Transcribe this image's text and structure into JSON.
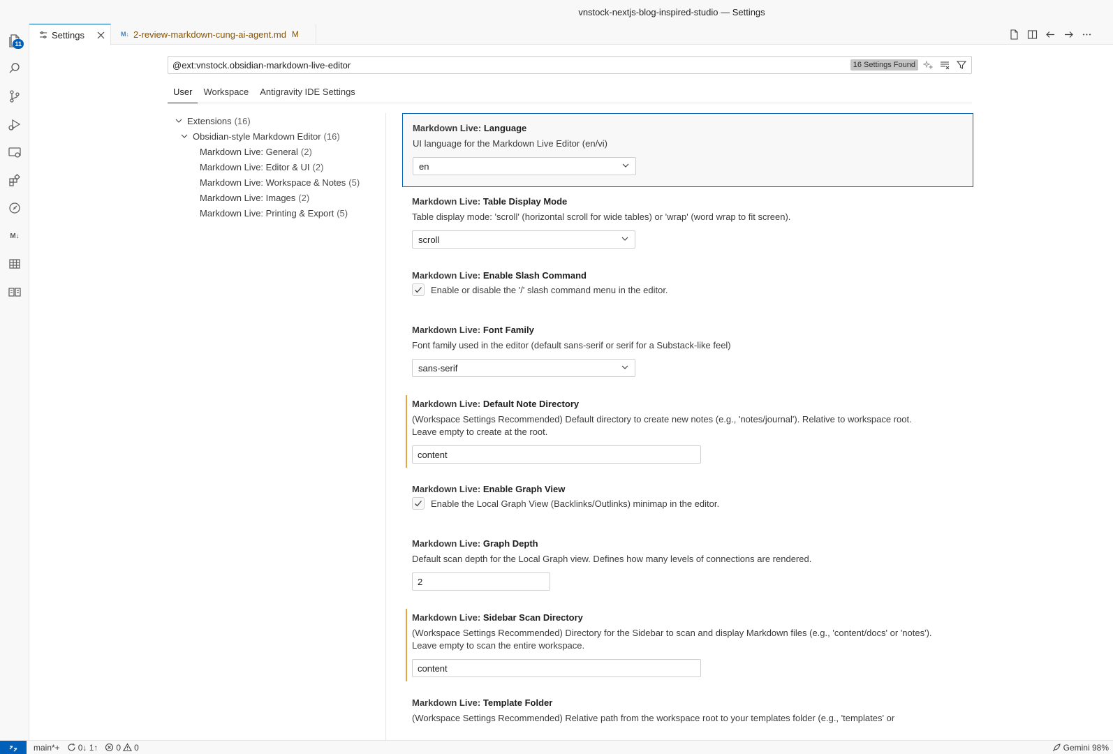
{
  "window": {
    "title": "vnstock-nextjs-blog-inspired-studio — Settings"
  },
  "activity_bar": {
    "explorer_badge": "11",
    "markdown_label": "M↓"
  },
  "tabs": [
    {
      "label": "Settings",
      "active": true
    },
    {
      "label": "2-review-markdown-cung-ai-agent.md",
      "flag": "M",
      "icon_text": "M↓"
    }
  ],
  "search": {
    "value": "@ext:vnstock.obsidian-markdown-live-editor",
    "results": "16 Settings Found"
  },
  "scopes": [
    "User",
    "Workspace",
    "Antigravity IDE Settings"
  ],
  "toc": [
    {
      "label": "Extensions",
      "count": "(16)"
    },
    {
      "label": "Obsidian-style Markdown Editor",
      "count": "(16)"
    },
    {
      "label": "Markdown Live: General",
      "count": "(2)"
    },
    {
      "label": "Markdown Live: Editor & UI",
      "count": "(2)"
    },
    {
      "label": "Markdown Live: Workspace & Notes",
      "count": "(5)"
    },
    {
      "label": "Markdown Live: Images",
      "count": "(2)"
    },
    {
      "label": "Markdown Live: Printing & Export",
      "count": "(5)"
    }
  ],
  "settings": [
    {
      "category": "Markdown Live: ",
      "key": "Language",
      "desc": "UI language for the Markdown Live Editor (en/vi)",
      "value": "en"
    },
    {
      "category": "Markdown Live: ",
      "key": "Table Display Mode",
      "desc": "Table display mode: 'scroll' (horizontal scroll for wide tables) or 'wrap' (word wrap to fit screen).",
      "value": "scroll"
    },
    {
      "category": "Markdown Live: ",
      "key": "Enable Slash Command",
      "desc": "Enable or disable the '/' slash command menu in the editor."
    },
    {
      "category": "Markdown Live: ",
      "key": "Font Family",
      "desc": "Font family used in the editor (default sans-serif or serif for a Substack-like feel)",
      "value": "sans-serif"
    },
    {
      "category": "Markdown Live: ",
      "key": "Default Note Directory",
      "desc1": "(Workspace Settings Recommended) Default directory to create new notes (e.g., 'notes/journal'). Relative to workspace root.",
      "desc2": "Leave empty to create at the root.",
      "value": "content"
    },
    {
      "category": "Markdown Live: ",
      "key": "Enable Graph View",
      "desc": "Enable the Local Graph View (Backlinks/Outlinks) minimap in the editor."
    },
    {
      "category": "Markdown Live: ",
      "key": "Graph Depth",
      "desc": "Default scan depth for the Local Graph view. Defines how many levels of connections are rendered.",
      "value": "2"
    },
    {
      "category": "Markdown Live: ",
      "key": "Sidebar Scan Directory",
      "desc1": "(Workspace Settings Recommended) Directory for the Sidebar to scan and display Markdown files (e.g., 'content/docs' or 'notes').",
      "desc2": "Leave empty to scan the entire workspace.",
      "value": "content"
    },
    {
      "category": "Markdown Live: ",
      "key": "Template Folder",
      "desc": "(Workspace Settings Recommended) Relative path from the workspace root to your templates folder (e.g., 'templates' or"
    }
  ],
  "status_bar": {
    "branch": "main*+",
    "sync": "0↓ 1↑",
    "errors": "0",
    "warnings": "0",
    "gemini": "Gemini 98%"
  }
}
